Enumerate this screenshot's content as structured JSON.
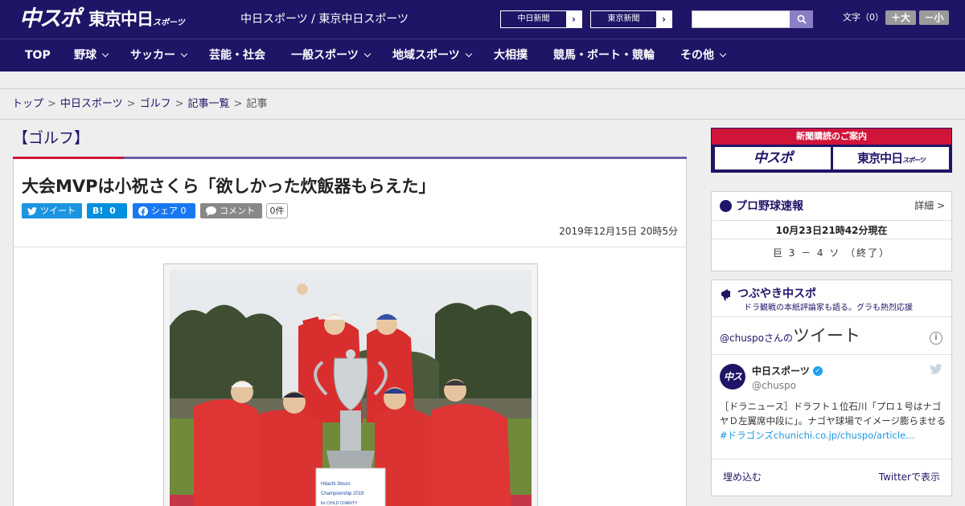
{
  "header": {
    "logo_chuspo": "中スポ",
    "logo_tokyo": "東京中日",
    "logo_tokyo_small": "スポーツ",
    "site_name": "中日スポーツ / 東京中日スポーツ",
    "link_chunichi": "中日新聞",
    "link_tokyo": "東京新聞",
    "search_placeholder": "",
    "font_label": "文字（0）",
    "font_large": "＋大",
    "font_small": "－小"
  },
  "nav": [
    {
      "label": "TOP",
      "dropdown": false
    },
    {
      "label": "野球",
      "dropdown": true
    },
    {
      "label": "サッカー",
      "dropdown": true
    },
    {
      "label": "芸能・社会",
      "dropdown": false
    },
    {
      "label": "一般スポーツ",
      "dropdown": true
    },
    {
      "label": "地域スポーツ",
      "dropdown": true
    },
    {
      "label": "大相撲",
      "dropdown": false
    },
    {
      "label": "競馬・ボート・競輪",
      "dropdown": false
    },
    {
      "label": "その他",
      "dropdown": true
    }
  ],
  "breadcrumb": [
    "トップ",
    "中日スポーツ",
    "ゴルフ",
    "記事一覧",
    "記事"
  ],
  "breadcrumb_sep": ">",
  "article": {
    "category": "【ゴルフ】",
    "title": "大会MVPは小祝さくら「欲しかった炊飯器もらえた」",
    "share_tweet": "ツイート",
    "share_hatena": "B!",
    "share_hatena_count": "0",
    "share_fb": "シェア",
    "share_fb_count": "0",
    "share_comment": "コメント",
    "comment_count": "0件",
    "date": "2019年12月15日 20時5分",
    "trophy_text": "Hitachi 3tours Championship 2019 for CHILD CHARITY"
  },
  "sidebar": {
    "subscribe_head": "新聞購読のご案内",
    "subscribe_chuspo": "中スポ",
    "subscribe_tokyo": "東京中日",
    "subscribe_tokyo_small": "スポーツ",
    "baseball_title": "プロ野球速報",
    "baseball_more": "詳細 >",
    "baseball_time": "10月23日21時42分現在",
    "baseball_score": "巨 3 － 4 ソ （終了）",
    "tweets_title": "つぶやき中スポ",
    "tweets_sub": "ドラ観戦の本紙評論家も語る。グラも熱烈応援",
    "tweets_handle_prefix": "@chuspo",
    "tweets_san": "さんの",
    "tweets_big": "ツイート",
    "tweet_name": "中日スポーツ",
    "tweet_handle": "@chuspo",
    "tweet_avatar": "中スポ",
    "tweet_text": "［ドラニュース］ドラフト１位石川「プロ１号はナゴヤＤ左翼席中段に」。ナゴヤ球場でイメージ膨らませる",
    "tweet_hashtag": "#ドラゴンズ",
    "tweet_link": "chunichi.co.jp/chuspo/article…",
    "tweet_embed": "埋め込む",
    "tweet_view": "Twitterで表示"
  }
}
